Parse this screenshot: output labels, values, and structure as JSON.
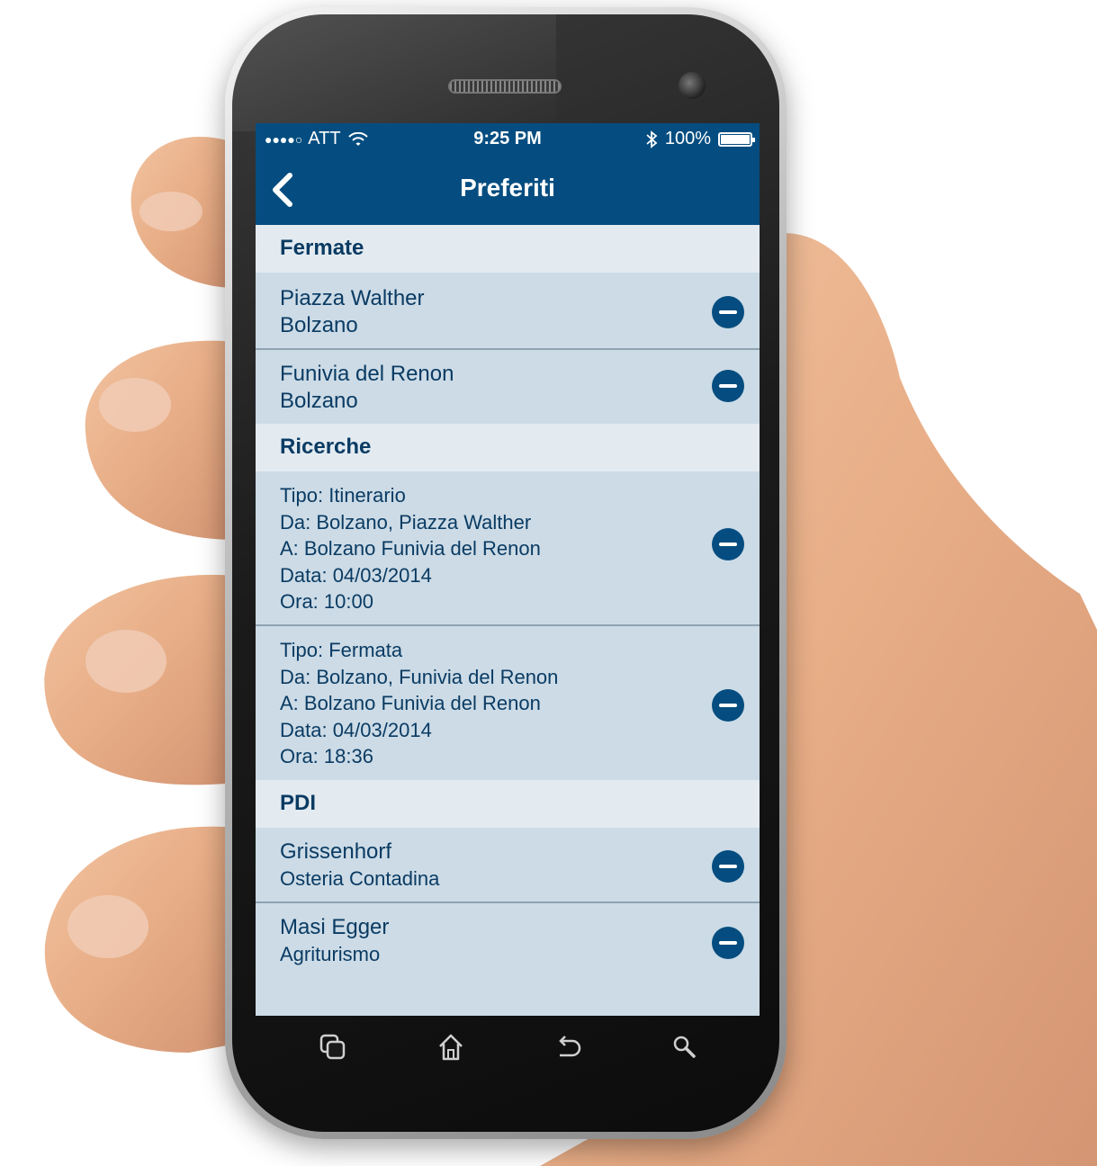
{
  "status_bar": {
    "signal": "●●●●○",
    "carrier": "ATT",
    "time": "9:25 PM",
    "battery": "100%",
    "battery_level": 1.0
  },
  "nav": {
    "title": "Preferiti",
    "back_icon": "chevron-left-icon"
  },
  "sections": {
    "fermate": {
      "header": "Fermate",
      "items": [
        {
          "title": "Piazza Walther",
          "subtitle": "Bolzano"
        },
        {
          "title": "Funivia del Renon",
          "subtitle": "Bolzano"
        }
      ]
    },
    "ricerche": {
      "header": "Ricerche",
      "items": [
        {
          "tipo": "Tipo: Itinerario",
          "da": "Da: Bolzano, Piazza Walther",
          "a": "A: Bolzano Funivia del Renon",
          "data": "Data: 04/03/2014",
          "ora": "Ora: 10:00"
        },
        {
          "tipo": "Tipo: Fermata",
          "da": "Da: Bolzano, Funivia del Renon",
          "a": "A: Bolzano Funivia del Renon",
          "data": "Data: 04/03/2014",
          "ora": "Ora: 18:36"
        }
      ]
    },
    "pdi": {
      "header": "PDI",
      "items": [
        {
          "title": "Grissenhorf",
          "subtitle": "Osteria Contadina"
        },
        {
          "title": "Masi Egger",
          "subtitle": "Agriturismo"
        }
      ]
    }
  },
  "hardware_buttons": [
    "recent-apps-icon",
    "home-icon",
    "back-icon",
    "search-icon"
  ],
  "colors": {
    "bar": "#054d80",
    "list_bg": "#ccdbe6",
    "section_bg": "#e3ebf1",
    "text": "#0a3b63"
  }
}
